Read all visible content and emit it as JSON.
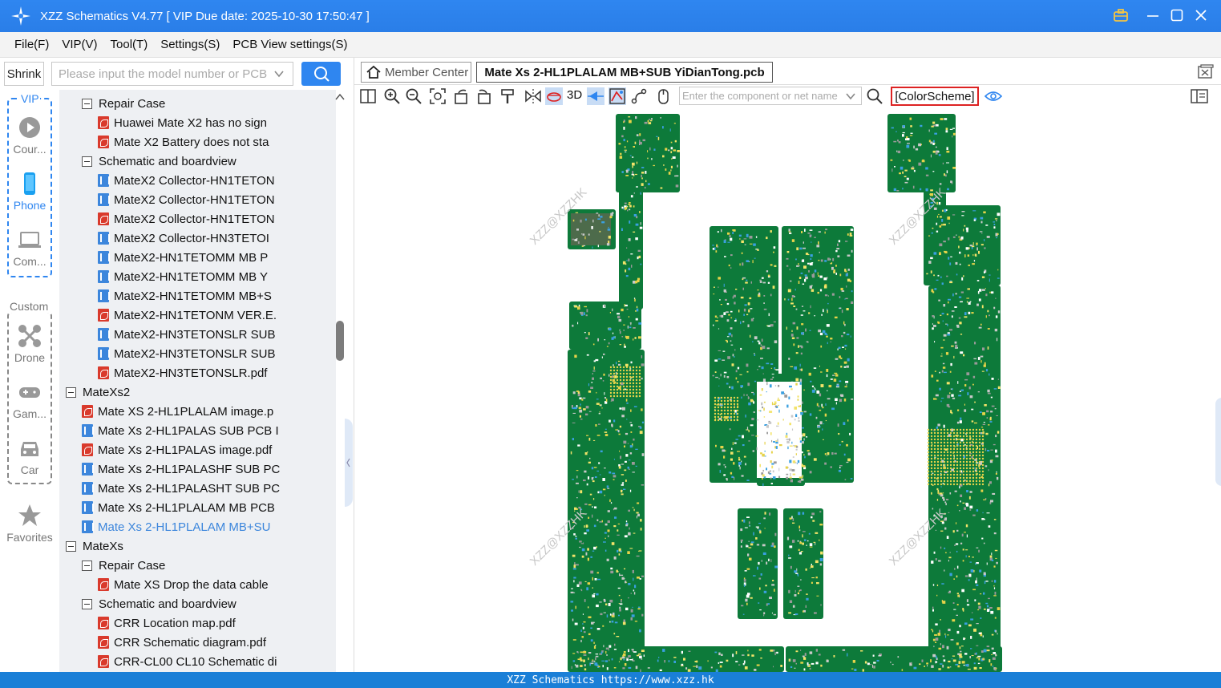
{
  "window": {
    "title": "XZZ Schematics V4.77 [ VIP Due date: 2025-10-30 17:50:47 ]"
  },
  "menu": [
    "File(F)",
    "VIP(V)",
    "Tool(T)",
    "Settings(S)",
    "PCB View settings(S)"
  ],
  "search": {
    "shrink_label": "Shrink",
    "placeholder": "Please input the model number or PCB"
  },
  "nav": {
    "vip_label": "VIP",
    "custom_label": "Custom",
    "items": [
      "Cour...",
      "Phone",
      "Com...",
      "Drone",
      "Gam...",
      "Car",
      "Favorites"
    ]
  },
  "tree": [
    {
      "level": 2,
      "kind": "folder",
      "label": "Repair Case"
    },
    {
      "level": 3,
      "kind": "pdf",
      "label": "Huawei Mate X2 has no sign"
    },
    {
      "level": 3,
      "kind": "pdf",
      "label": "Mate X2 Battery does not sta"
    },
    {
      "level": 2,
      "kind": "folder",
      "label": "Schematic and boardview"
    },
    {
      "level": 3,
      "kind": "pcb",
      "label": "MateX2 Collector-HN1TETON"
    },
    {
      "level": 3,
      "kind": "pcb",
      "label": "MateX2 Collector-HN1TETON"
    },
    {
      "level": 3,
      "kind": "pdf",
      "label": "MateX2 Collector-HN1TETON"
    },
    {
      "level": 3,
      "kind": "pcb",
      "label": "MateX2 Collector-HN3TETOI"
    },
    {
      "level": 3,
      "kind": "pcb",
      "label": "MateX2-HN1TETOMM MB P"
    },
    {
      "level": 3,
      "kind": "pcb",
      "label": "MateX2-HN1TETOMM MB Y"
    },
    {
      "level": 3,
      "kind": "pcb",
      "label": "MateX2-HN1TETOMM MB+S"
    },
    {
      "level": 3,
      "kind": "pdf",
      "label": "MateX2-HN1TETONM VER.E."
    },
    {
      "level": 3,
      "kind": "pcb",
      "label": "MateX2-HN3TETONSLR SUB"
    },
    {
      "level": 3,
      "kind": "pcb",
      "label": "MateX2-HN3TETONSLR SUB"
    },
    {
      "level": 3,
      "kind": "pdf",
      "label": "MateX2-HN3TETONSLR.pdf"
    },
    {
      "level": 1,
      "kind": "folder",
      "label": "MateXs2"
    },
    {
      "level": 2,
      "kind": "pdf",
      "label": "Mate XS 2-HL1PLALAM image.p"
    },
    {
      "level": 2,
      "kind": "pcb",
      "label": "Mate Xs 2-HL1PALAS SUB PCB I"
    },
    {
      "level": 2,
      "kind": "pdf",
      "label": "Mate Xs 2-HL1PALAS image.pdf"
    },
    {
      "level": 2,
      "kind": "pcb",
      "label": "Mate Xs 2-HL1PALASHF SUB PC"
    },
    {
      "level": 2,
      "kind": "pcb",
      "label": "Mate Xs 2-HL1PALASHT SUB PC"
    },
    {
      "level": 2,
      "kind": "pcb",
      "label": "Mate Xs 2-HL1PLALAM MB PCB"
    },
    {
      "level": 2,
      "kind": "pcb",
      "label": "Mate Xs 2-HL1PLALAM MB+SU",
      "selected": true
    },
    {
      "level": 1,
      "kind": "folder",
      "label": "MateXs"
    },
    {
      "level": 2,
      "kind": "folder",
      "label": "Repair Case"
    },
    {
      "level": 3,
      "kind": "pdf",
      "label": "Mate XS Drop the data cable"
    },
    {
      "level": 2,
      "kind": "folder",
      "label": "Schematic and boardview"
    },
    {
      "level": 3,
      "kind": "pdf",
      "label": "CRR Location map.pdf"
    },
    {
      "level": 3,
      "kind": "pdf",
      "label": "CRR Schematic diagram.pdf"
    },
    {
      "level": 3,
      "kind": "pdf",
      "label": "CRR-CL00 CL10 Schematic di"
    }
  ],
  "tabs": {
    "member": "Member Center",
    "file": "Mate Xs 2-HL1PLALAM MB+SUB YiDianTong.pcb"
  },
  "toolbar": {
    "three_d": "3D",
    "component_placeholder": "Enter the component or net name",
    "color_scheme": "[ColorScheme]"
  },
  "pcb": {
    "watermark": "XZZ@XZZHK",
    "board_color": "#0d7a3a"
  },
  "footer": "XZZ Schematics https://www.xzz.hk",
  "colors": {
    "accent": "#2f86f0",
    "selected_text": "#3c86dc",
    "pdf_icon": "#d93a2c"
  }
}
